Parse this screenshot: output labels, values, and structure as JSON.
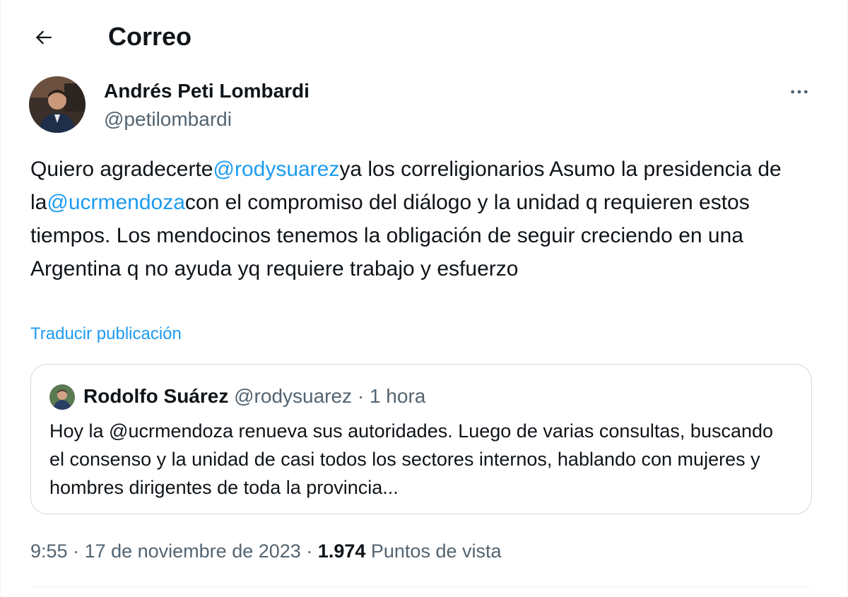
{
  "header": {
    "back_icon": "arrow-left-icon",
    "title": "Correo"
  },
  "post": {
    "author_name": "Andrés Peti Lombardi",
    "author_handle": "@petilombardi",
    "more_icon": "more-horizontal-icon",
    "text_parts": {
      "p1": "Quiero agradecerte",
      "mention1": "@rodysuarez",
      "p2": "ya los correligionarios Asumo la presidencia de la",
      "mention2": "@ucrmendoza",
      "p3": "con el compromiso del diálogo y la unidad q requieren estos tiempos. Los mendocinos tenemos la obligación de seguir creciendo en una Argentina q no ayuda yq requiere trabajo y esfuerzo"
    },
    "translate_label": "Traducir publicación",
    "time": "9:55",
    "date": "17 de noviembre de 2023",
    "views_count": "1.974",
    "views_label": "Puntos de vista"
  },
  "quote": {
    "author_name": "Rodolfo Suárez",
    "author_handle": "@rodysuarez",
    "separator": "·",
    "time": "1 hora",
    "text": "Hoy la @ucrmendoza renueva sus autoridades. Luego de varias consultas, buscando el consenso y la unidad de casi todos los sectores internos, hablando con mujeres y hombres dirigentes de toda la provincia..."
  },
  "colors": {
    "link": "#1d9bf0",
    "muted": "#536471",
    "text": "#0f1419",
    "border": "#cfd9de"
  }
}
